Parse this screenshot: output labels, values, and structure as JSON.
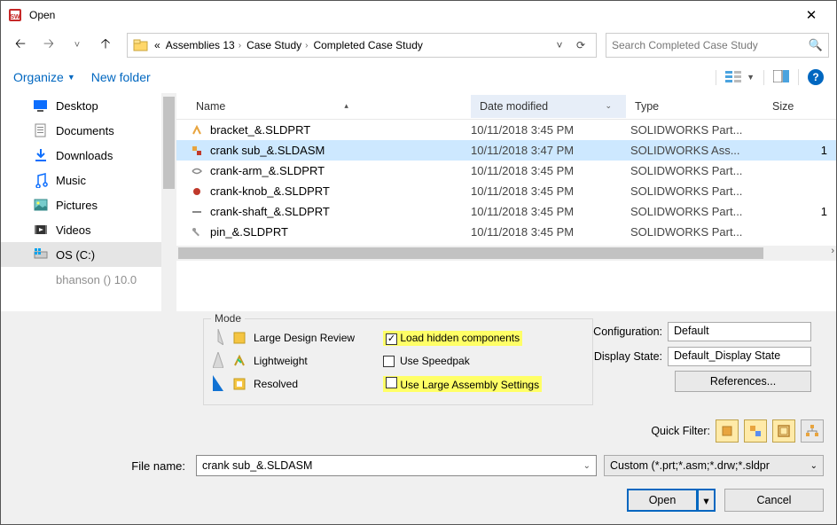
{
  "window": {
    "title": "Open"
  },
  "breadcrumbs": {
    "root": "«",
    "b1": "Assemblies 13",
    "b2": "Case Study",
    "b3": "Completed Case Study"
  },
  "search": {
    "placeholder": "Search Completed Case Study"
  },
  "toolbar": {
    "organize": "Organize",
    "newfolder": "New folder"
  },
  "sidebar": {
    "items": [
      {
        "label": "Desktop"
      },
      {
        "label": "Documents"
      },
      {
        "label": "Downloads"
      },
      {
        "label": "Music"
      },
      {
        "label": "Pictures"
      },
      {
        "label": "Videos"
      },
      {
        "label": "OS (C:)"
      },
      {
        "label": "bhanson () 10.0"
      }
    ]
  },
  "columns": {
    "name": "Name",
    "date": "Date modified",
    "type": "Type",
    "size": "Size"
  },
  "files": [
    {
      "name": "bracket_&.SLDPRT",
      "date": "10/11/2018 3:45 PM",
      "type": "SOLIDWORKS Part...",
      "size": ""
    },
    {
      "name": "crank sub_&.SLDASM",
      "date": "10/11/2018 3:47 PM",
      "type": "SOLIDWORKS Ass...",
      "size": "1"
    },
    {
      "name": "crank-arm_&.SLDPRT",
      "date": "10/11/2018 3:45 PM",
      "type": "SOLIDWORKS Part...",
      "size": ""
    },
    {
      "name": "crank-knob_&.SLDPRT",
      "date": "10/11/2018 3:45 PM",
      "type": "SOLIDWORKS Part...",
      "size": ""
    },
    {
      "name": "crank-shaft_&.SLDPRT",
      "date": "10/11/2018 3:45 PM",
      "type": "SOLIDWORKS Part...",
      "size": "1"
    },
    {
      "name": "pin_&.SLDPRT",
      "date": "10/11/2018 3:45 PM",
      "type": "SOLIDWORKS Part...",
      "size": ""
    }
  ],
  "mode": {
    "legend": "Mode",
    "opt1": "Large Design Review",
    "opt2": "Lightweight",
    "opt3": "Resolved",
    "chk1": "Load hidden components",
    "chk2": "Use Speedpak",
    "chk3": "Use Large Assembly Settings"
  },
  "config": {
    "label": "Configuration:",
    "value": "Default",
    "dslabel": "Display State:",
    "dsvalue": "Default_Display State",
    "refs": "References..."
  },
  "quickfilter": {
    "label": "Quick Filter:"
  },
  "filename": {
    "label": "File name:",
    "value": "crank sub_&.SLDASM"
  },
  "filetype": {
    "value": "Custom (*.prt;*.asm;*.drw;*.sldpr"
  },
  "buttons": {
    "open": "Open",
    "cancel": "Cancel"
  }
}
